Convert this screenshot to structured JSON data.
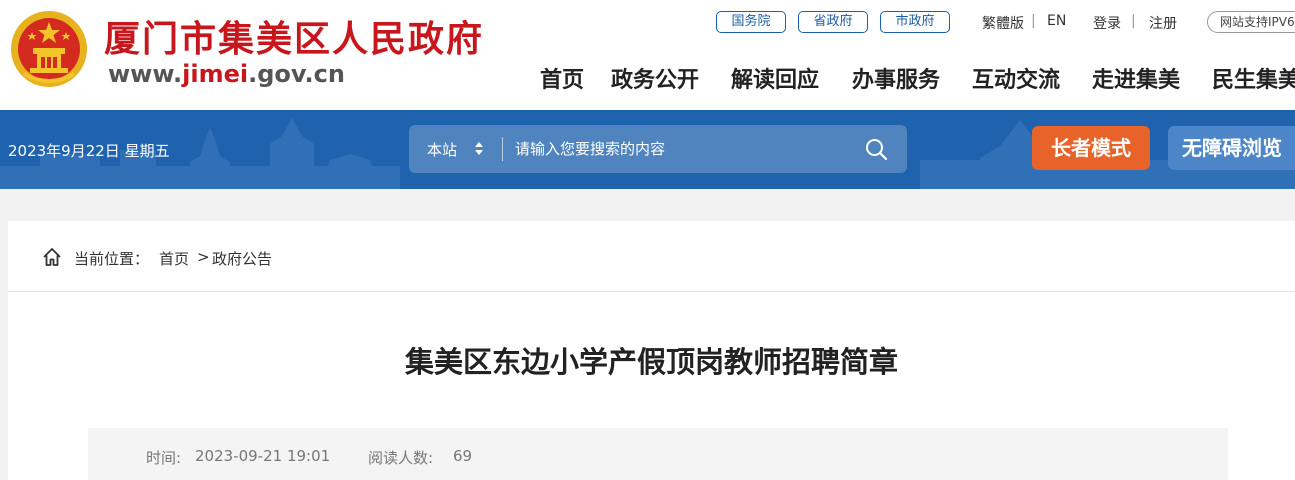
{
  "header": {
    "site_title": "厦门市集美区人民政府",
    "url_prefix": "www.",
    "url_domain": "jimei",
    "url_suffix": ".gov.cn",
    "links": {
      "state_council": "国务院",
      "province_gov": "省政府",
      "city_gov": "市政府",
      "traditional": "繁體版",
      "english": "EN",
      "login": "登录",
      "register": "注册",
      "ipv6": "网站支持IPV6"
    },
    "nav": [
      "首页",
      "政务公开",
      "解读回应",
      "办事服务",
      "互动交流",
      "走进集美",
      "民生集美"
    ]
  },
  "banner": {
    "date": "2023年9月22日 星期五",
    "search_scope": "本站",
    "search_placeholder": "请输入您要搜索的内容",
    "elder_mode": "长者模式",
    "accessibility": "无障碍浏览"
  },
  "breadcrumb": {
    "label": "当前位置：",
    "home": "首页",
    "separator": ">",
    "current": "政府公告"
  },
  "article": {
    "title": "集美区东边小学产假顶岗教师招聘简章",
    "time_label": "时间:",
    "time_value": "2023-09-21 19:01",
    "views_label": "阅读人数:",
    "views_value": "69"
  },
  "colors": {
    "brand_red": "#c8161d",
    "banner_blue": "#1f62ad",
    "elder_orange": "#e7632a"
  }
}
